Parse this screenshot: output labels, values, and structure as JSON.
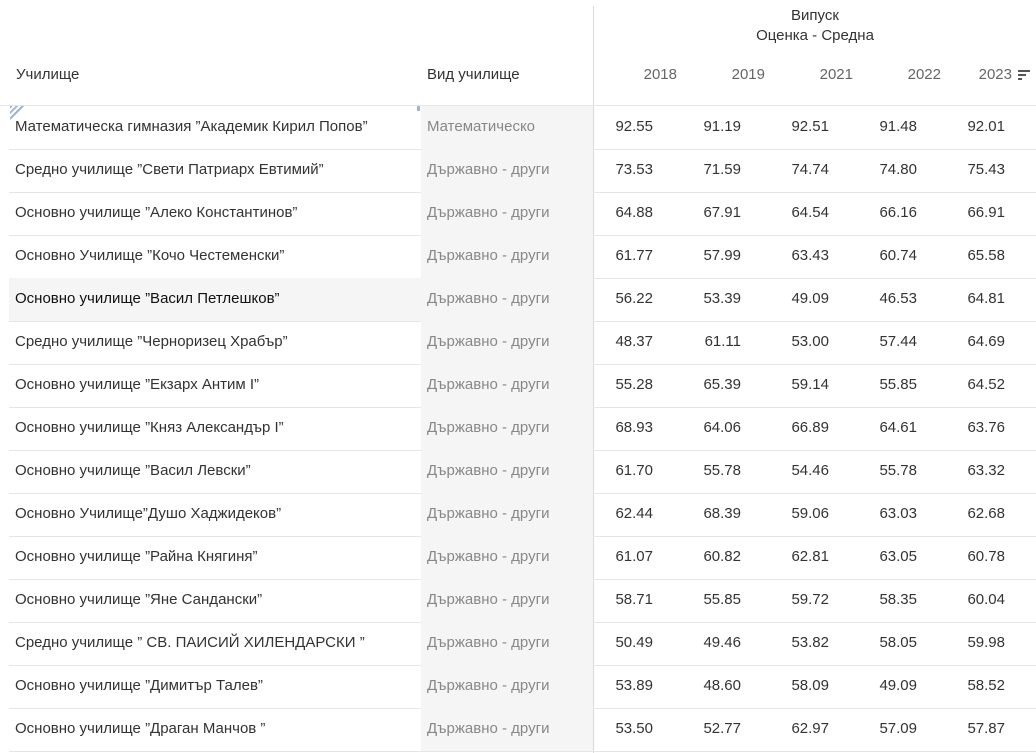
{
  "header": {
    "group_title": "Випуск",
    "measure_title": "Оценка - Средна",
    "school_col": "Училище",
    "type_col": "Вид училище",
    "years": [
      "2018",
      "2019",
      "2021",
      "2022",
      "2023"
    ],
    "sort_icon": "sort-descending-icon"
  },
  "rows": [
    {
      "school": "Математическа гимназия ”Академик Кирил Попов”",
      "type": "Математическо",
      "values": [
        "92.55",
        "91.19",
        "92.51",
        "91.48",
        "92.01"
      ]
    },
    {
      "school": "Средно училище ”Свети Патриарх Евтимий”",
      "type": "Държавно - други",
      "values": [
        "73.53",
        "71.59",
        "74.74",
        "74.80",
        "75.43"
      ]
    },
    {
      "school": "Основно училище ”Алеко Константинов”",
      "type": "Държавно - други",
      "values": [
        "64.88",
        "67.91",
        "64.54",
        "66.16",
        "66.91"
      ]
    },
    {
      "school": "Основно Училище ”Кочо Честеменски”",
      "type": "Държавно - други",
      "values": [
        "61.77",
        "57.99",
        "63.43",
        "60.74",
        "65.58"
      ]
    },
    {
      "school": "Основно училище ”Васил Петлешков”",
      "type": "Държавно - други",
      "values": [
        "56.22",
        "53.39",
        "49.09",
        "46.53",
        "64.81"
      ]
    },
    {
      "school": "Средно училище ”Черноризец Храбър”",
      "type": "Държавно - други",
      "values": [
        "48.37",
        "61.11",
        "53.00",
        "57.44",
        "64.69"
      ]
    },
    {
      "school": "Основно училище ”Екзарх Антим I”",
      "type": "Държавно - други",
      "values": [
        "55.28",
        "65.39",
        "59.14",
        "55.85",
        "64.52"
      ]
    },
    {
      "school": "Основно училище ”Княз Александър I”",
      "type": "Държавно - други",
      "values": [
        "68.93",
        "64.06",
        "66.89",
        "64.61",
        "63.76"
      ]
    },
    {
      "school": "Основно училище ”Васил Левски”",
      "type": "Държавно - други",
      "values": [
        "61.70",
        "55.78",
        "54.46",
        "55.78",
        "63.32"
      ]
    },
    {
      "school": "Основно Училище”Душо Хаджидеков”",
      "type": "Държавно - други",
      "values": [
        "62.44",
        "68.39",
        "59.06",
        "63.03",
        "62.68"
      ]
    },
    {
      "school": "Основно училище ”Райна Княгиня”",
      "type": "Държавно - други",
      "values": [
        "61.07",
        "60.82",
        "62.81",
        "63.05",
        "60.78"
      ]
    },
    {
      "school": "Основно училище ”Яне Сандански”",
      "type": "Държавно - други",
      "values": [
        "58.71",
        "55.85",
        "59.72",
        "58.35",
        "60.04"
      ]
    },
    {
      "school": "Средно училище ” СВ. ПАИСИЙ ХИЛЕНДАРСКИ ”",
      "type": "Държавно - други",
      "values": [
        "50.49",
        "49.46",
        "53.82",
        "58.05",
        "59.98"
      ]
    },
    {
      "school": "Основно училище ”Димитър Талев”",
      "type": "Държавно - други",
      "values": [
        "53.89",
        "48.60",
        "58.09",
        "49.09",
        "58.52"
      ]
    },
    {
      "school": "Основно училище ”Драган Манчов ”",
      "type": "Държавно - други",
      "values": [
        "53.50",
        "52.77",
        "62.97",
        "57.09",
        "57.87"
      ]
    }
  ],
  "highlighted_row_index": 4,
  "colors": {
    "row_shade": "#f5f5f5",
    "grid_line": "#e6e6e6",
    "selection_mark": "#9ab6d6"
  }
}
